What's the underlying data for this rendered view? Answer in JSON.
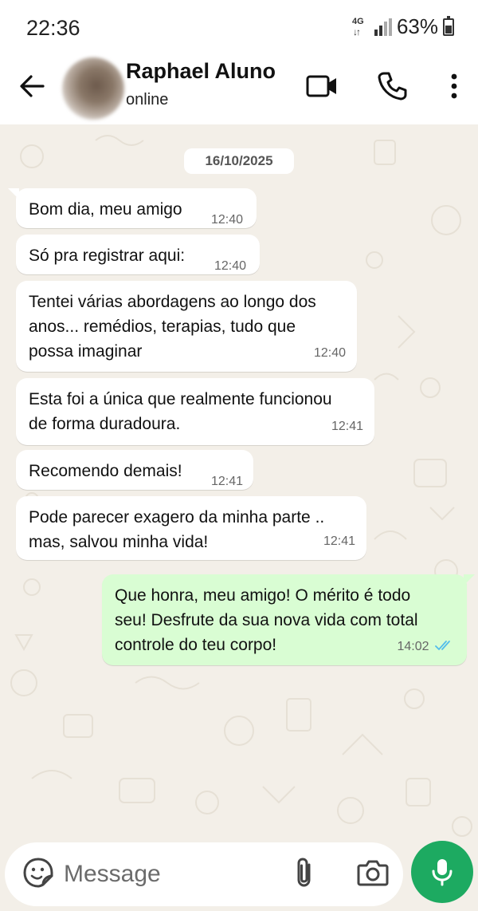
{
  "status_bar": {
    "time": "22:36",
    "network": "4G",
    "battery": "63%"
  },
  "header": {
    "contact_name": "Raphael Aluno",
    "contact_status": "online",
    "icons": [
      "back-arrow-icon",
      "avatar",
      "video-call-icon",
      "phone-icon",
      "more-vert-icon"
    ]
  },
  "chat": {
    "date_chip": "16/10/2025",
    "messages": [
      {
        "direction": "in",
        "text": "Bom dia, meu amigo",
        "time": "12:40"
      },
      {
        "direction": "in",
        "text": "Só pra registrar aqui:",
        "time": "12:40"
      },
      {
        "direction": "in",
        "lines": [
          "Tentei várias abordagens ao longo dos",
          "anos... remédios, terapias, tudo que",
          "possa imaginar"
        ],
        "time": "12:40"
      },
      {
        "direction": "in",
        "lines": [
          "Esta foi a única que realmente funcionou",
          "de forma duradoura."
        ],
        "time": "12:41"
      },
      {
        "direction": "in",
        "text": "Recomendo demais!",
        "time": "12:41"
      },
      {
        "direction": "in",
        "lines": [
          "Pode parecer exagero da minha parte ..",
          "mas, salvou minha vida!"
        ],
        "time": "12:41"
      },
      {
        "direction": "out",
        "lines": [
          "Que honra, meu amigo! O mérito é todo",
          "seu! Desfrute da sua nova vida com total",
          "controle do teu corpo!"
        ],
        "time": "14:02",
        "status": "read"
      }
    ]
  },
  "composer": {
    "placeholder": "Message",
    "value": ""
  },
  "colors": {
    "header_bg": "#ffffff",
    "chat_bg": "#f3efe8",
    "incoming_bubble": "#ffffff",
    "outgoing_bubble": "#d9fdd3",
    "accent_green": "#1daa61",
    "read_ticks": "#53bdeb"
  }
}
